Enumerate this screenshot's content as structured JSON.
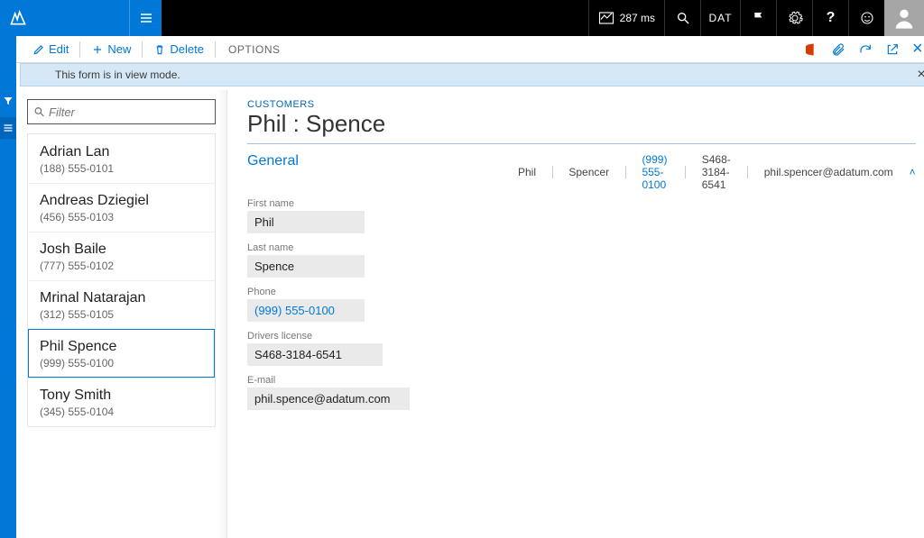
{
  "topbar": {
    "perf_ms": "287 ms",
    "dat_label": "DAT"
  },
  "toolbar": {
    "edit_label": "Edit",
    "new_label": "New",
    "delete_label": "Delete",
    "options_label": "OPTIONS"
  },
  "infobar": {
    "message": "This form is in view mode.",
    "close": "×"
  },
  "filter": {
    "placeholder": "Filter"
  },
  "customers": [
    {
      "name": "Adrian Lan",
      "phone": "(188) 555-0101"
    },
    {
      "name": "Andreas Dziegiel",
      "phone": "(456) 555-0103"
    },
    {
      "name": "Josh Baile",
      "phone": "(777) 555-0102"
    },
    {
      "name": "Mrinal Natarajan",
      "phone": "(312) 555-0105"
    },
    {
      "name": "Phil Spence",
      "phone": "(999) 555-0100"
    },
    {
      "name": "Tony Smith",
      "phone": "(345) 555-0104"
    }
  ],
  "selected_index": 4,
  "detail": {
    "breadcrumb": "CUSTOMERS",
    "title": "Phil : Spence",
    "section": "General",
    "summary": {
      "first": "Phil",
      "last": "Spencer",
      "phone": "(999) 555-0100",
      "license": "S468-3184-6541",
      "email": "phil.spencer@adatum.com"
    },
    "fields": {
      "first_name_label": "First name",
      "first_name": "Phil",
      "last_name_label": "Last name",
      "last_name": "Spence",
      "phone_label": "Phone",
      "phone": "(999) 555-0100",
      "license_label": "Drivers license",
      "license": "S468-3184-6541",
      "email_label": "E-mail",
      "email": "phil.spence@adatum.com"
    }
  }
}
